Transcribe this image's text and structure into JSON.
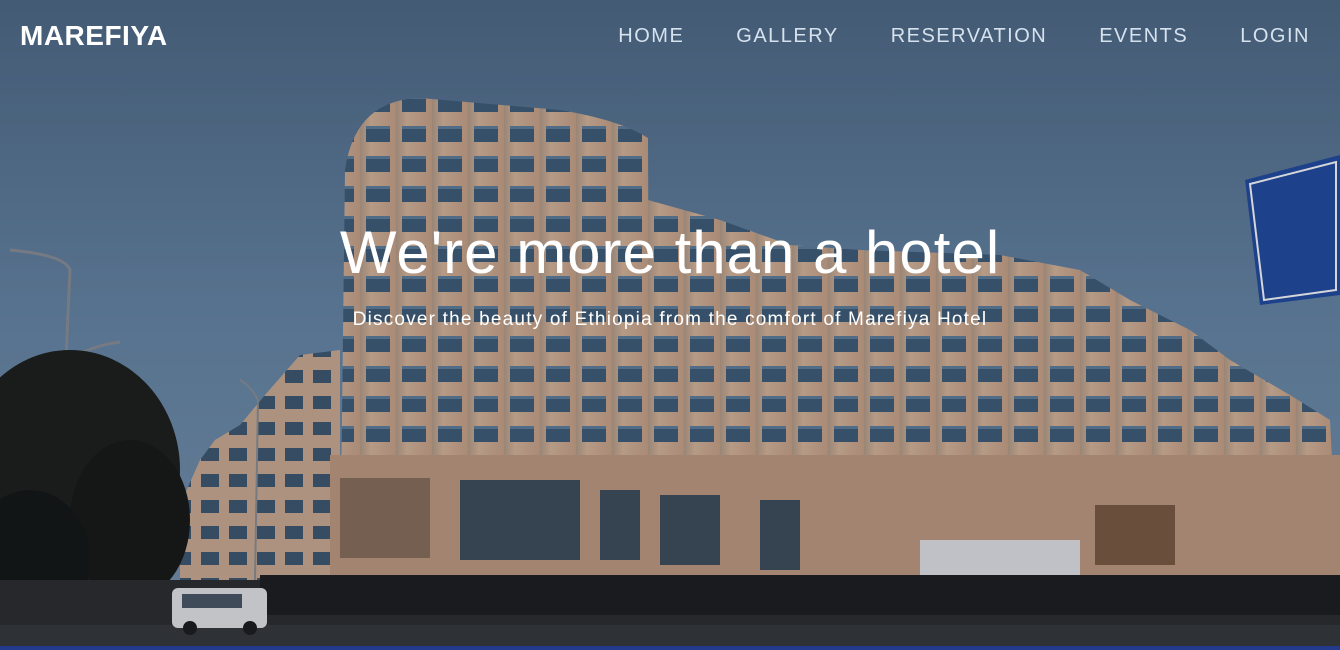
{
  "brand": {
    "name": "MAREFIYA"
  },
  "nav": {
    "items": [
      {
        "label": "HOME"
      },
      {
        "label": "GALLERY"
      },
      {
        "label": "RESERVATION"
      },
      {
        "label": "EVENTS"
      },
      {
        "label": "LOGIN"
      }
    ]
  },
  "hero": {
    "title": "We're more than a hotel",
    "subtitle": "Discover the beauty of Ethiopia from the comfort of Marefiya Hotel"
  },
  "colors": {
    "nav_text": "#d6e2ee",
    "brand_text": "#ffffff",
    "bottom_line": "#233a8c"
  }
}
